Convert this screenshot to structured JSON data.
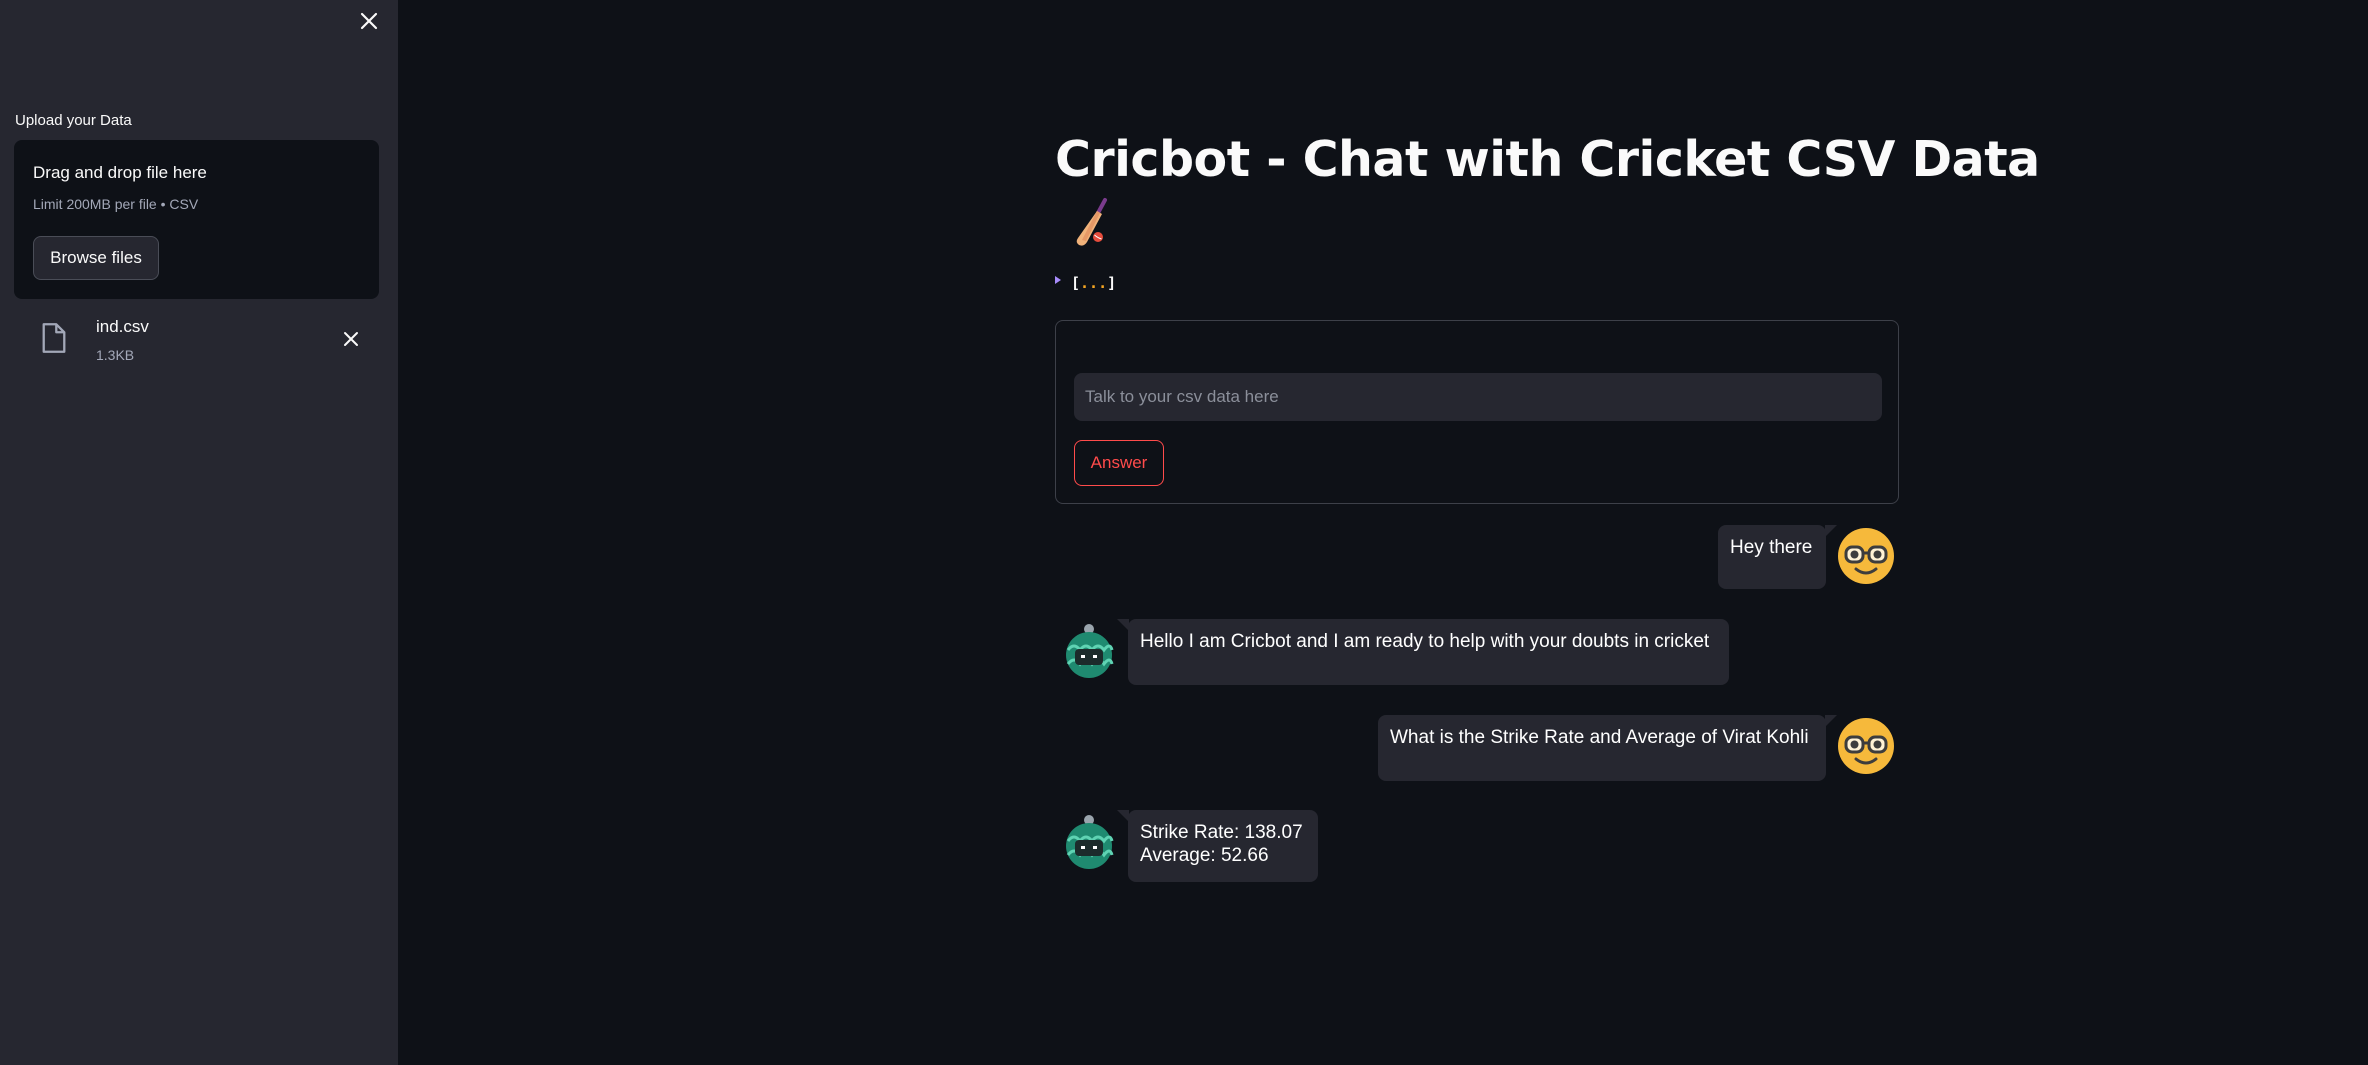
{
  "sidebar": {
    "upload_label": "Upload your Data",
    "dropzone_title": "Drag and drop file here",
    "dropzone_limit": "Limit 200MB per file • CSV",
    "browse_label": "Browse files",
    "file": {
      "name": "ind.csv",
      "size": "1.3KB",
      "icon": "file-icon"
    }
  },
  "main": {
    "title": "Cricbot - Chat with Cricket CSV Data",
    "title_icon": "cricket-bat-icon",
    "json_preview": {
      "open": "[",
      "dots": "...",
      "close": "]"
    },
    "input_placeholder": "Talk to your csv data here",
    "answer_label": "Answer"
  },
  "messages": [
    {
      "role": "user",
      "text": "Hey there",
      "avatar": "nerd-face-avatar"
    },
    {
      "role": "bot",
      "text": "Hello I am Cricbot and I am ready to help with your doubts in cricket",
      "avatar": "robot-avatar"
    },
    {
      "role": "user",
      "text": "What is the Strike Rate and Average of Virat Kohli",
      "avatar": "nerd-face-avatar"
    },
    {
      "role": "bot",
      "lines": [
        "Strike Rate: 138.07",
        "Average: 52.66"
      ],
      "avatar": "robot-avatar"
    }
  ],
  "colors": {
    "background": "#0e1117",
    "sidebar": "#262730",
    "accent": "#ff4b4b",
    "bubble": "#262730"
  }
}
